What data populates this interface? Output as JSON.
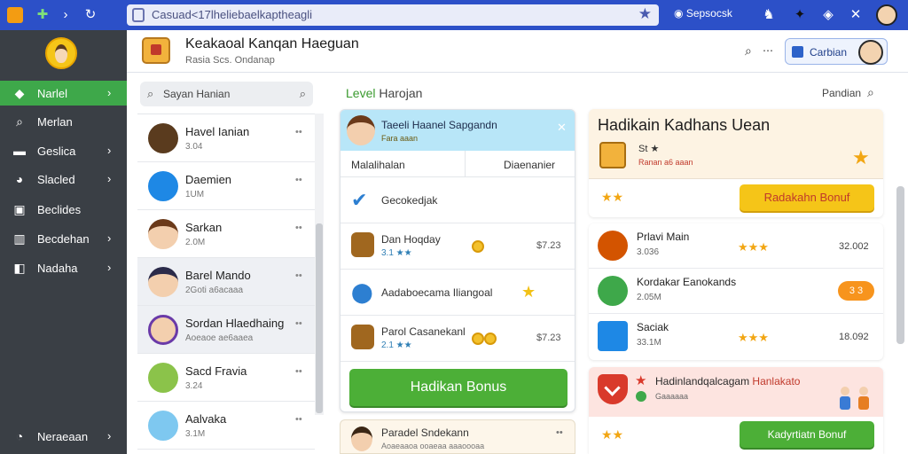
{
  "browser": {
    "url": "Casuad<17lheliebaelkaptheagli",
    "profile_label": "Sepsocsk"
  },
  "nav": {
    "items": [
      {
        "label": "Narlel",
        "icon": "gem-icon",
        "active": true
      },
      {
        "label": "Merlan",
        "icon": "search-icon"
      },
      {
        "label": "Geslica",
        "icon": "flag-icon"
      },
      {
        "label": "Slacled",
        "icon": "puzzle-icon"
      },
      {
        "label": "Beclides",
        "icon": "folder-icon"
      },
      {
        "label": "Becdehan",
        "icon": "chart-icon"
      },
      {
        "label": "Nadaha",
        "icon": "box-icon"
      },
      {
        "label": "Neraeaan",
        "icon": "globe-icon"
      }
    ]
  },
  "header": {
    "title": "Keakaoal Kanqan Haeguan",
    "subtitle": "Rasia Scs. Ondanap",
    "button_label": "Carbian"
  },
  "search": {
    "placeholder": "Sayan Hanian"
  },
  "contacts": [
    {
      "name": "Havel Ianian",
      "sub": "3.04"
    },
    {
      "name": "Daemien",
      "sub": "1UM"
    },
    {
      "name": "Sarkan",
      "sub": "2.0M"
    },
    {
      "name": "Barel Mando",
      "sub": "2Goti a6acaaa"
    },
    {
      "name": "Sordan Hlaedhaing",
      "sub": "Aoeaoe ae6aaea"
    },
    {
      "name": "Sacd Fravia",
      "sub": "3.24"
    },
    {
      "name": "Aalvaka",
      "sub": "3.1M"
    }
  ],
  "level": {
    "label_accent": "Level",
    "label_rest": "Harojan",
    "card": {
      "title": "Taeeli Haanel Sapgandn",
      "subtitle": "Fara aaan",
      "tab_left": "Malalihalan",
      "tab_right": "Diaenanier",
      "items": [
        {
          "label": "Gecokedjak",
          "sub": "",
          "value": ""
        },
        {
          "label": "Dan Hoqday",
          "sub": "3.1 ★★",
          "value": "$7.23"
        },
        {
          "label": "Aadaboecama Iliangoal",
          "sub": "",
          "value": ""
        },
        {
          "label": "Parol Casanekanl",
          "sub": "2.1 ★★",
          "value": "$7.23"
        }
      ],
      "button_label": "Hadikan Bonus"
    },
    "card2": {
      "title": "Paradel Sndekann",
      "subtitle": "Aoaeaaoa ooaeaa aaaoooaa"
    }
  },
  "right": {
    "header_label": "Pandian",
    "panel": {
      "title": "Hadikain Kadhans Uean",
      "level_line": "St ★",
      "sub_line": "Ranan a6 aaan",
      "stars": "★★",
      "button_label": "Radakahn Bonuf"
    },
    "items": [
      {
        "name": "Prlavi Main",
        "sub": "3.036",
        "stars": "★★★",
        "value": "32.002"
      },
      {
        "name": "Kordakar Eanokands",
        "sub": "2.05M",
        "stars": "",
        "pill": "3 3"
      },
      {
        "name": "Saciak",
        "sub": "33.1M",
        "stars": "★★★",
        "value": "18.092"
      }
    ],
    "promo": {
      "title_main": "Hadinlandqalcagam",
      "title_accent": "Hanlakato",
      "subtitle": "Gaaaaaa",
      "stars": "★★",
      "button_label": "Kadyrtiatn Bonuf"
    }
  },
  "colors": {
    "chrome": "#2c50c8",
    "nav_bg": "#3a3f45",
    "nav_active": "#3ea84a",
    "accent_green": "#4caf37",
    "accent_yellow": "#f5c518"
  }
}
